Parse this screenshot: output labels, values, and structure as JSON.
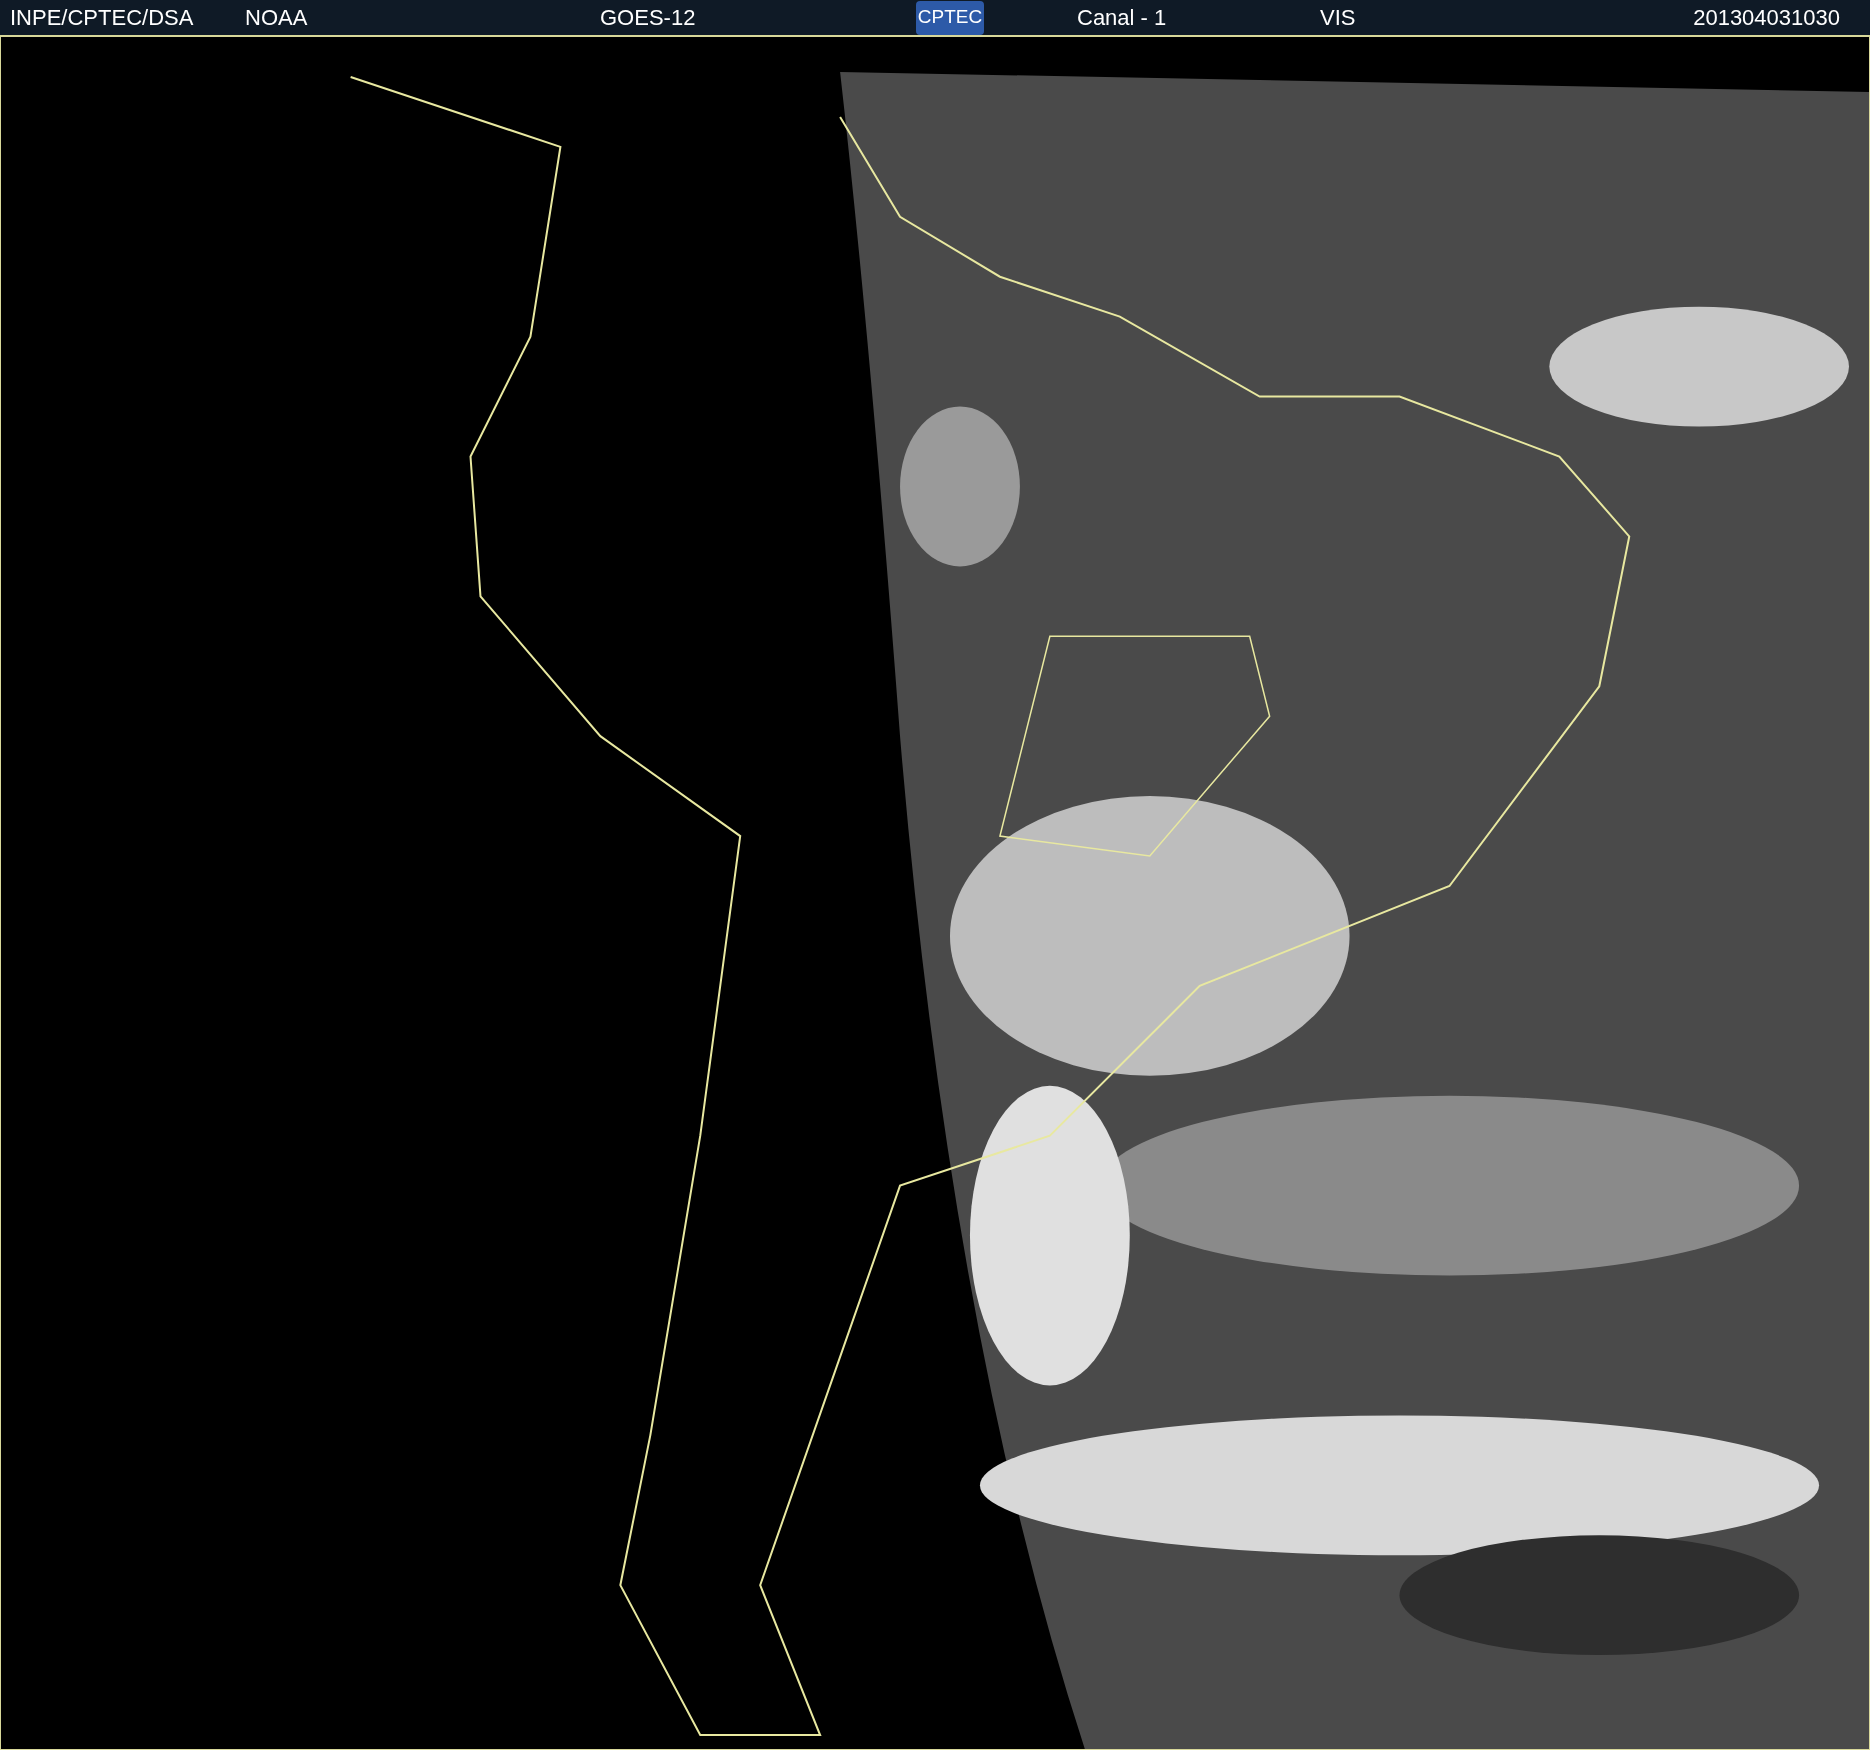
{
  "header": {
    "source": "INPE/CPTEC/DSA",
    "agency": "NOAA",
    "satellite": "GOES-12",
    "logo": "CPTEC",
    "channel": "Canal - 1",
    "band": "VIS",
    "timestamp": "201304031030"
  }
}
